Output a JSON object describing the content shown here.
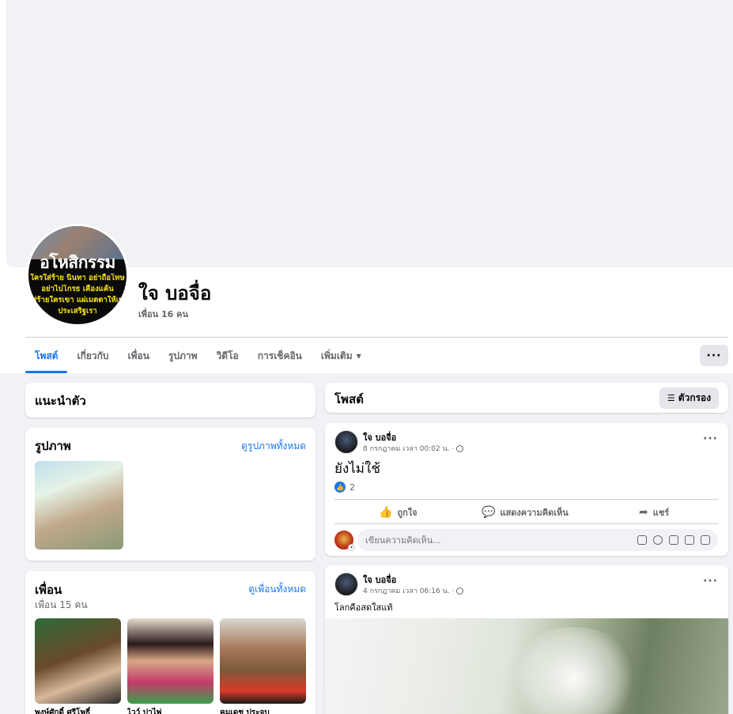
{
  "profile": {
    "name": "ใจ บอจื่อ",
    "friends_count": "เพื่อน 16 คน",
    "avatar": {
      "title": "อโหสิกรรม",
      "lines": [
        "ใครใส่ร้าย นินทา อย่าถือโทษ",
        "อย่าไปโกรธ เคืองแค้น",
        "ใส่ร้ายใครเขา แผ่เมตตาให้เขาเถิด",
        "ประเสริฐเรา"
      ]
    }
  },
  "nav": {
    "tabs": [
      {
        "label": "โพสต์",
        "active": true
      },
      {
        "label": "เกี่ยวกับ",
        "active": false
      },
      {
        "label": "เพื่อน",
        "active": false
      },
      {
        "label": "รูปภาพ",
        "active": false
      },
      {
        "label": "วิดีโอ",
        "active": false
      },
      {
        "label": "การเช็คอิน",
        "active": false
      },
      {
        "label": "เพิ่มเติม",
        "active": false
      }
    ],
    "more_label": "···"
  },
  "intro": {
    "title": "แนะนำตัว"
  },
  "photos": {
    "title": "รูปภาพ",
    "see_all": "ดูรูปภาพทั้งหมด"
  },
  "friends": {
    "title": "เพื่อน",
    "count": "เพื่อน 15 คน",
    "see_all": "ดูเพื่อนทั้งหมด",
    "items": [
      {
        "name": "พงษ์ศักดิ์ ศรีโพธิ์"
      },
      {
        "name": "ไวว์ ปาไพ่"
      },
      {
        "name": "คมเดช ประจบ"
      }
    ]
  },
  "posts_header": {
    "title": "โพสต์",
    "filter_label": "ตัวกรอง"
  },
  "posts": [
    {
      "author": "ใจ บอจื่อ",
      "time": "8 กรกฎาคม เวลา 00:02 น. ·",
      "text": "ยังไม่ใช้",
      "reaction_count": "2",
      "actions": {
        "like": "ถูกใจ",
        "comment": "แสดงความคิดเห็น",
        "share": "แชร์"
      },
      "comment_placeholder": "เขียนความคิดเห็น..."
    },
    {
      "author": "ใจ บอจื่อ",
      "time": "4 กรกฎาคม เวลา 06:16 น. ·",
      "text": "โลกคือสดใสแท้"
    }
  ],
  "colors": {
    "accent": "#1877f2",
    "page_bg": "#f0f2f5",
    "muted_text": "#65676b",
    "avatar_text": "#f5e11a"
  }
}
